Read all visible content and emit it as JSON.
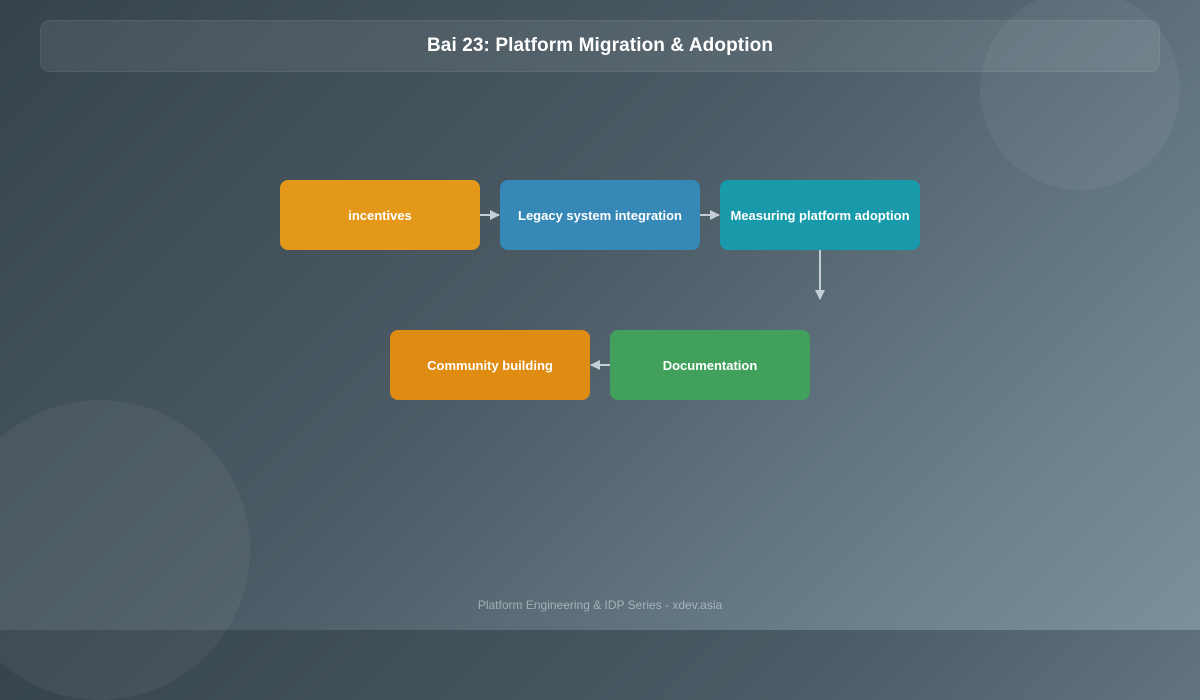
{
  "header": {
    "title": "Bai 23: Platform Migration & Adoption"
  },
  "nodes": [
    {
      "label": "incentives",
      "color": "#e3981a"
    },
    {
      "label": "Legacy system integration",
      "color": "#3688b6"
    },
    {
      "label": "Measuring platform adoption",
      "color": "#189aaa"
    },
    {
      "label": "Documentation",
      "color": "#41a15c"
    },
    {
      "label": "Community building",
      "color": "#e08b12"
    }
  ],
  "edges": [
    {
      "from": "incentives",
      "to": "Legacy system integration"
    },
    {
      "from": "Legacy system integration",
      "to": "Measuring platform adoption"
    },
    {
      "from": "Measuring platform adoption",
      "to": "Documentation"
    },
    {
      "from": "Documentation",
      "to": "Community building"
    }
  ],
  "footer": {
    "text": "Platform Engineering & IDP Series - xdev.asia"
  }
}
